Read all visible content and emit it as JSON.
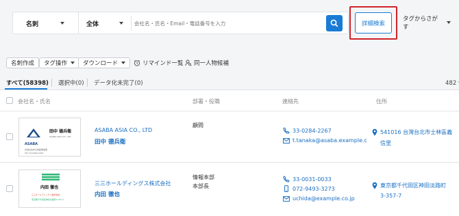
{
  "search": {
    "scope_select": "名刺",
    "field_select": "全体",
    "placeholder": "会社名・氏名・Email・電話番号を入力",
    "advanced_button": "詳細検索",
    "tag_search": "タグからさがす"
  },
  "toolbar": {
    "create_card": "名刺作成",
    "tag_ops": "タグ操作",
    "download": "ダウンロード",
    "reminders": "リマインド一覧",
    "duplicates": "同一人物候補"
  },
  "tabs": {
    "all": "すべて(58398)",
    "selected": "選択中(0)",
    "incomplete": "データ化未完了(0)",
    "count_label": "482 件"
  },
  "table": {
    "headers": {
      "company_name": "会社名・氏名",
      "dept_title": "部署・役職",
      "contact": "連絡先",
      "address": "住所"
    },
    "rows": [
      {
        "company": "ASABA ASIA CO., LTD",
        "name": "田中 德兵衛",
        "dept": "",
        "title": "顧問",
        "phone": "33-0284-2267",
        "mobile": "",
        "email": "t.tanaka@asaba.example.c",
        "address_line1": "541016 台灣台北市士林區義",
        "address_line2": "信里",
        "card_name": "田中 德兵衛",
        "card_logo": "ASABA",
        "card_lines": [
          "ASABA ASIA CO., LTD",
          "台灣台北市士林區義信里",
          "TEL 33-0284-2267"
        ]
      },
      {
        "company": "三三ホールディングス株式会社",
        "name": "内田 徹也",
        "dept": "情報本部",
        "title": "本部長",
        "phone": "33-0031-0033",
        "mobile": "072-9493-3273",
        "email": "uchida@example.co.jp",
        "address_line1": "東京都千代田区神田淡路町",
        "address_line2": "3-357-7",
        "card_name": "内田 徹也",
        "card_logo": "",
        "card_lines": [
          "三三ホールディングス株式会社",
          "東京都千代田区神田淡路町3-357-7"
        ]
      }
    ]
  },
  "colors": {
    "primary": "#1a7bd4",
    "highlight_border": "#d0222a",
    "link": "#1a6fc2"
  }
}
